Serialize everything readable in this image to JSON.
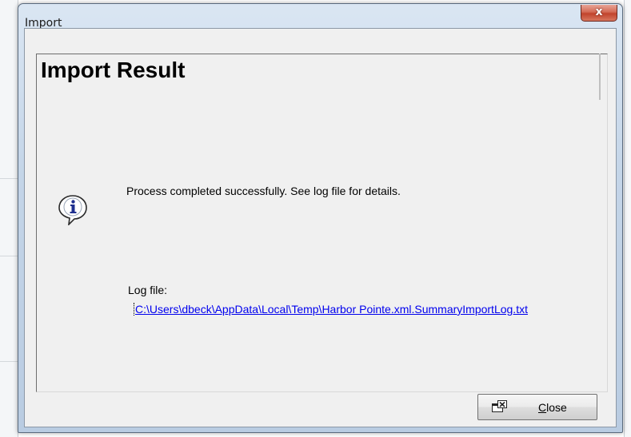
{
  "window": {
    "title": "Import",
    "close_glyph": "x"
  },
  "dialog": {
    "heading": "Import Result",
    "icon": "info-icon",
    "message": "Process completed successfully. See log file for details.",
    "log_label": "Log file:",
    "log_path": "C:\\Users\\dbeck\\AppData\\Local\\Temp\\Harbor Pointe.xml.SummaryImportLog.txt"
  },
  "buttons": {
    "close": {
      "mnemonic": "C",
      "rest": "lose",
      "icon": "close-window-icon"
    }
  },
  "colors": {
    "link": "#0000ee",
    "dialog_bg": "#f0f0f0",
    "title_close": "#c1432c"
  }
}
